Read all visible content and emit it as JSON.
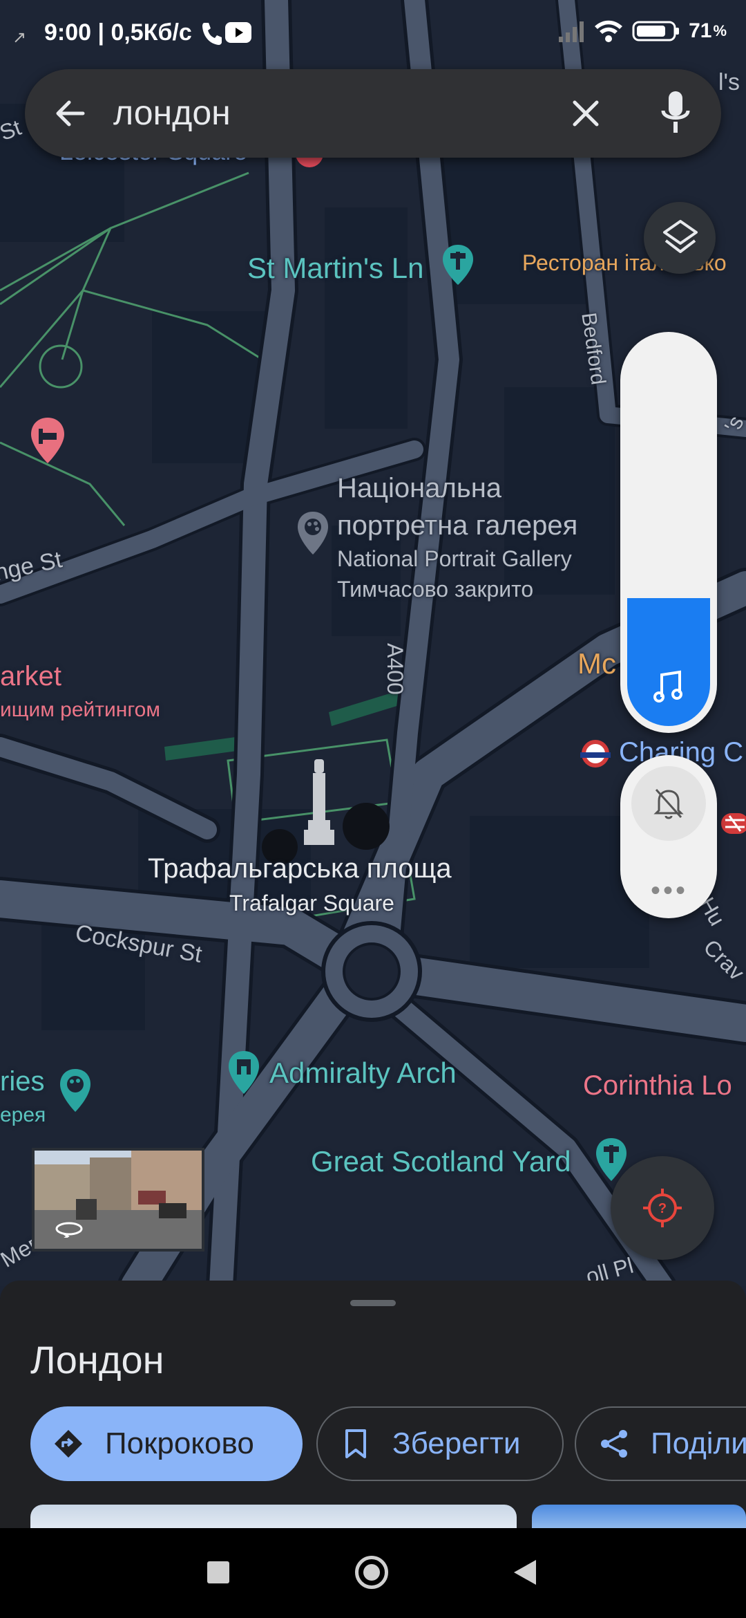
{
  "status_bar": {
    "time": "9:00 | 0,5Кб/с",
    "battery": "71"
  },
  "search": {
    "query": "лондон"
  },
  "map_labels": {
    "leicester_square": "Leicester Square",
    "st_martins_ln": "St Martin's Ln",
    "restaurant": "Ресторан італійсько",
    "bedford": "Bedford",
    "npg_uk_line1": "Національна",
    "npg_uk_line2": "портретна галерея",
    "npg_en": "National Portrait Gallery",
    "npg_status": "Тимчасово закрито",
    "range_st": "nge St",
    "market": "arket",
    "market_sub": "ищим рейтингом",
    "a400": "A400",
    "mcdonalds": "Mc",
    "charing_cross": "Charing C",
    "trafalgar_uk": "Трафальгарська площа",
    "trafalgar_en": "Trafalgar Square",
    "cockspur_st": "Cockspur St",
    "admiralty_arch": "Admiralty Arch",
    "galleries": "ries",
    "galleries_sub": "ерея",
    "corinthia": "Corinthia Lo",
    "great_scotland_yard": "Great Scotland Yard",
    "craven": "Crav",
    "hu": "Hu",
    "mer": "Мег",
    "pl": "oll Pl",
    "st_left": "St",
    "ps_right": "'s",
    "l_s_right": "l's"
  },
  "volume": {
    "level_percent": 33
  },
  "place_sheet": {
    "title": "Лондон",
    "actions": {
      "directions": "Покроково",
      "save": "Зберегти",
      "share": "Поділи"
    }
  },
  "colors": {
    "accent_blue": "#8ab4f8",
    "volume_blue": "#1a7df2",
    "teal_poi": "#5bc4c0",
    "pink_poi": "#ec7588",
    "location_button": "#e8453c"
  }
}
